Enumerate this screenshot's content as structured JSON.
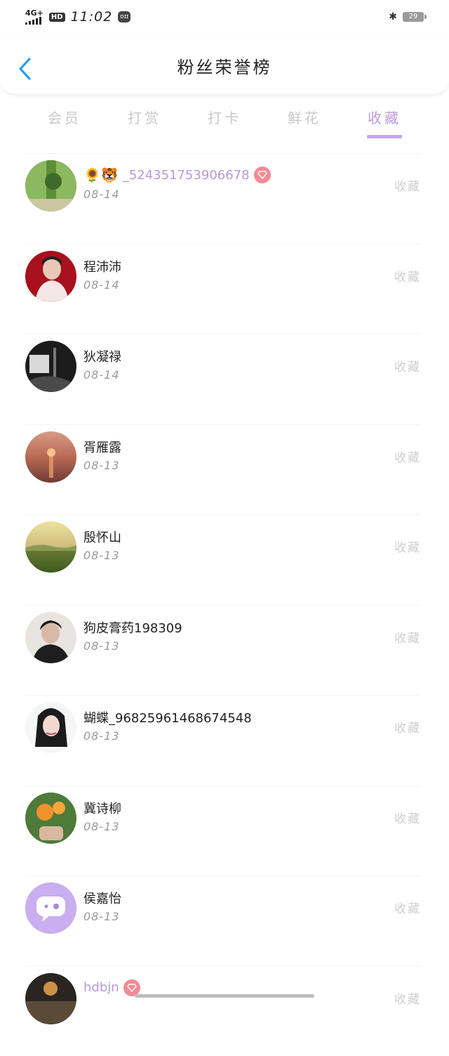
{
  "status_bar": {
    "network": "4G+",
    "hd": "HD",
    "time": "11:02",
    "app_icon": "dji-icon",
    "bluetooth_icon": "bluetooth-icon",
    "battery": "29"
  },
  "header": {
    "back_icon": "chevron-left-icon",
    "title": "粉丝荣誉榜"
  },
  "tabs": [
    {
      "label": "会员",
      "active": false
    },
    {
      "label": "打赏",
      "active": false
    },
    {
      "label": "打卡",
      "active": false
    },
    {
      "label": "鲜花",
      "active": false
    },
    {
      "label": "收藏",
      "active": true
    }
  ],
  "colors": {
    "accent": "#c6a8e6",
    "back": "#2a9df4",
    "vip_badge": "#f28b95",
    "muted": "#cfcfcf"
  },
  "rows": [
    {
      "name_prefix": "🌻🐯",
      "name": "_524351753906678",
      "date": "08-14",
      "action": "收藏",
      "vip": true,
      "purple": true
    },
    {
      "name": "程沛沛",
      "date": "08-14",
      "action": "收藏"
    },
    {
      "name": "狄凝禄",
      "date": "08-14",
      "action": "收藏"
    },
    {
      "name": "胥雁露",
      "date": "08-13",
      "action": "收藏"
    },
    {
      "name": "殷怀山",
      "date": "08-13",
      "action": "收藏"
    },
    {
      "name": "狗皮膏药198309",
      "date": "08-13",
      "action": "收藏"
    },
    {
      "name": "蝴蝶_968259614686745​48",
      "date": "08-13",
      "action": "收藏"
    },
    {
      "name": "冀诗柳",
      "date": "08-13",
      "action": "收藏"
    },
    {
      "name": "侯嘉怡",
      "date": "08-13",
      "action": "收藏"
    },
    {
      "name": "hdbjn",
      "date": "",
      "action": "收藏",
      "vip": true,
      "purple": true
    }
  ]
}
